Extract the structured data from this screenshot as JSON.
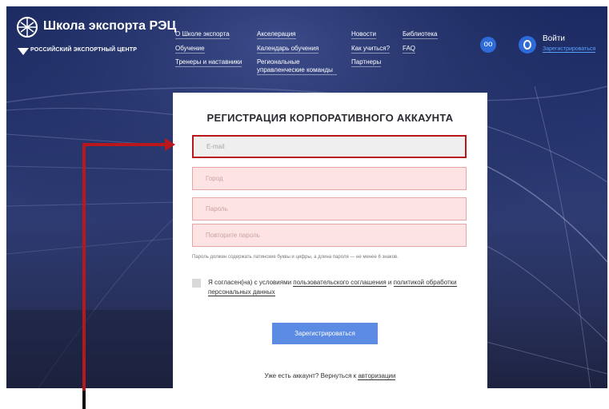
{
  "header": {
    "logo_title": "Школа экспорта РЭЦ",
    "logo_subtitle": "Российский экспортный центр",
    "nav": [
      {
        "label": "О Школе экспорта"
      },
      {
        "label": "Обучение"
      },
      {
        "label": "Тренеры и наставники"
      },
      {
        "label": "Акселерация"
      },
      {
        "label": "Календарь обучения"
      },
      {
        "label": "Региональные управленческие команды"
      },
      {
        "label": "Новости"
      },
      {
        "label": "Как учиться?"
      },
      {
        "label": "Партнеры"
      },
      {
        "label": "Библиотека"
      },
      {
        "label": "FAQ"
      }
    ],
    "accessibility_icon": "glasses-icon",
    "accessibility_glyph": "oo",
    "login_label": "Войти",
    "register_label": "Зарегистрироваться"
  },
  "form": {
    "title": "РЕГИСТРАЦИЯ КОРПОРАТИВНОГО АККАУНТА",
    "fields": [
      {
        "placeholder": "E-mail"
      },
      {
        "placeholder": "Город"
      },
      {
        "placeholder": "Пароль"
      },
      {
        "placeholder": "Повторите пароль"
      }
    ],
    "hint": "Пароль должен содержать латинские буквы и цифры, а длина пароля — не менее 6 знаков.",
    "agree_prefix": "Я согласен(на) с условиями ",
    "agree_link1": "пользовательского соглашения",
    "agree_mid": " и ",
    "agree_link2": "политикой обработки персональных данных",
    "submit_label": "Зарегистрироваться",
    "already_prefix": "Уже есть аккаунт? Вернуться к ",
    "already_link": "авторизации"
  },
  "colors": {
    "accent": "#b8181c",
    "button": "#5b8be2",
    "field_error_bg": "#fde3e3"
  }
}
